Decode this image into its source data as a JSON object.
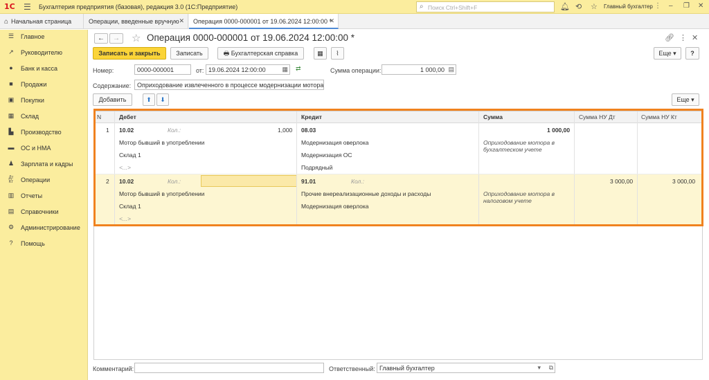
{
  "titlebar": {
    "logo": "1С",
    "app_title": "Бухгалтерия предприятия (базовая), редакция 3.0  (1С:Предприятие)",
    "search_placeholder": "Поиск Ctrl+Shift+F",
    "user": "Главный бухгалтер"
  },
  "tabs": {
    "home": "Начальная страница",
    "items": [
      {
        "label": "Операции, введенные вручную"
      },
      {
        "label": "Операция 0000-000001 от 19.06.2024 12:00:00 *"
      }
    ]
  },
  "sidebar": {
    "items": [
      {
        "label": "Главное",
        "icon": "menu-icon"
      },
      {
        "label": "Руководителю",
        "icon": "trend-icon"
      },
      {
        "label": "Банк и касса",
        "icon": "coin-icon"
      },
      {
        "label": "Продажи",
        "icon": "bag-icon"
      },
      {
        "label": "Покупки",
        "icon": "basket-icon"
      },
      {
        "label": "Склад",
        "icon": "warehouse-icon"
      },
      {
        "label": "Производство",
        "icon": "factory-icon"
      },
      {
        "label": "ОС и НМА",
        "icon": "truck-icon"
      },
      {
        "label": "Зарплата и кадры",
        "icon": "person-icon"
      },
      {
        "label": "Операции",
        "icon": "dt-kt-icon"
      },
      {
        "label": "Отчеты",
        "icon": "chart-icon"
      },
      {
        "label": "Справочники",
        "icon": "book-icon"
      },
      {
        "label": "Администрирование",
        "icon": "gear-icon"
      },
      {
        "label": "Помощь",
        "icon": "question-icon"
      }
    ]
  },
  "document": {
    "title": "Операция 0000-000001 от 19.06.2024 12:00:00 *",
    "more_label": "Еще",
    "help_label": "?"
  },
  "toolbar": {
    "save_close": "Записать и закрыть",
    "save": "Записать",
    "report": "Бухгалтерская справка"
  },
  "form": {
    "number_label": "Номер:",
    "number_value": "0000-000001",
    "date_label": "от:",
    "date_value": "19.06.2024 12:00:00",
    "sum_label": "Сумма операции:",
    "sum_value": "1 000,00",
    "content_label": "Содержание:",
    "content_value": "Оприходование извлеченного в процессе модернизации мотора"
  },
  "table_toolbar": {
    "add": "Добавить",
    "more": "Еще"
  },
  "table": {
    "headers": {
      "n": "N",
      "debit": "Дебет",
      "credit": "Кредит",
      "sum": "Сумма",
      "sum_nu_dt": "Сумма НУ Дт",
      "sum_nu_kt": "Сумма НУ Кт"
    },
    "rows": [
      {
        "n": "1",
        "debit_account": "10.02",
        "qty_label": "Кол.:",
        "qty": "1,000",
        "debit_sub1": "Мотор бывший в употреблении",
        "debit_sub2": "Склад 1",
        "debit_sub3": "<...>",
        "credit_account": "08.03",
        "credit_sub1": "Модернизация оверлока",
        "credit_sub2": "Модернизация ОС",
        "credit_sub3": "Подрядный",
        "sum": "1 000,00",
        "sum_comment_1": "Оприходование мотора в",
        "sum_comment_2": "бухгалтеском учете"
      },
      {
        "n": "2",
        "debit_account": "10.02",
        "qty_label": "Кол.:",
        "credit_qty_label": "Кол.:",
        "debit_sub1": "Мотор бывший в употреблении",
        "debit_sub2": "Склад 1",
        "debit_sub3": "<...>",
        "credit_account": "91.01",
        "credit_sub1": "Прочие внереализационные доходы и расходы",
        "credit_sub2": "Модернизация оверлока",
        "sum_comment_1": "Оприходование мотора в",
        "sum_comment_2": "налоговом учете",
        "sum_nu_dt": "3 000,00",
        "sum_nu_kt": "3 000,00"
      }
    ]
  },
  "footer": {
    "comment_label": "Комментарий:",
    "comment_value": "",
    "responsible_label": "Ответственный:",
    "responsible_value": "Главный бухгалтер"
  },
  "colors": {
    "sidebar_bg": "#fbed9e",
    "primary_button": "#fbd438",
    "highlight_border": "#f0821f",
    "selected_row": "#fdf6d2"
  }
}
